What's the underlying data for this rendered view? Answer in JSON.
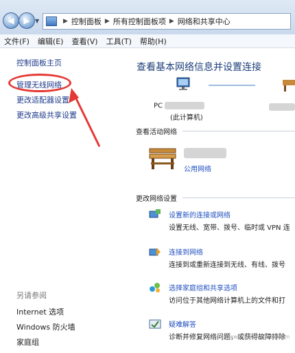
{
  "breadcrumbs": [
    "控制面板",
    "所有控制面板项",
    "网络和共享中心"
  ],
  "menu": [
    "文件(F)",
    "编辑(E)",
    "查看(V)",
    "工具(T)",
    "帮助(H)"
  ],
  "left_pane": {
    "links": [
      "控制面板主页",
      "管理无线网络",
      "更改适配器设置",
      "更改高级共享设置"
    ],
    "see_also_title": "另请参阅",
    "see_also": [
      "Internet 选项",
      "Windows 防火墙",
      "家庭组"
    ]
  },
  "main": {
    "title": "查看基本网络信息并设置连接",
    "pc_label_prefix": "PC",
    "pc_sub": "(此计算机)",
    "active_networks_title": "查看活动网络",
    "network_type": "公用网络",
    "change_settings_title": "更改网络设置",
    "tasks": [
      {
        "title": "设置新的连接或网络",
        "desc": "设置无线、宽带、拨号、临时或 VPN 连"
      },
      {
        "title": "连接到网络",
        "desc": "连接到或重新连接到无线、有线、拨号"
      },
      {
        "title": "选择家庭组和共享选项",
        "desc": "访问位于其他网络计算机上的文件和打"
      },
      {
        "title": "疑难解答",
        "desc": "诊断并修复网络问题，或获得故障排除"
      }
    ]
  },
  "watermark": "www.jingyan.baidu.com",
  "colors": {
    "annotation": "#e53935",
    "link": "#1f4fbf",
    "title": "#1e3f7a"
  }
}
